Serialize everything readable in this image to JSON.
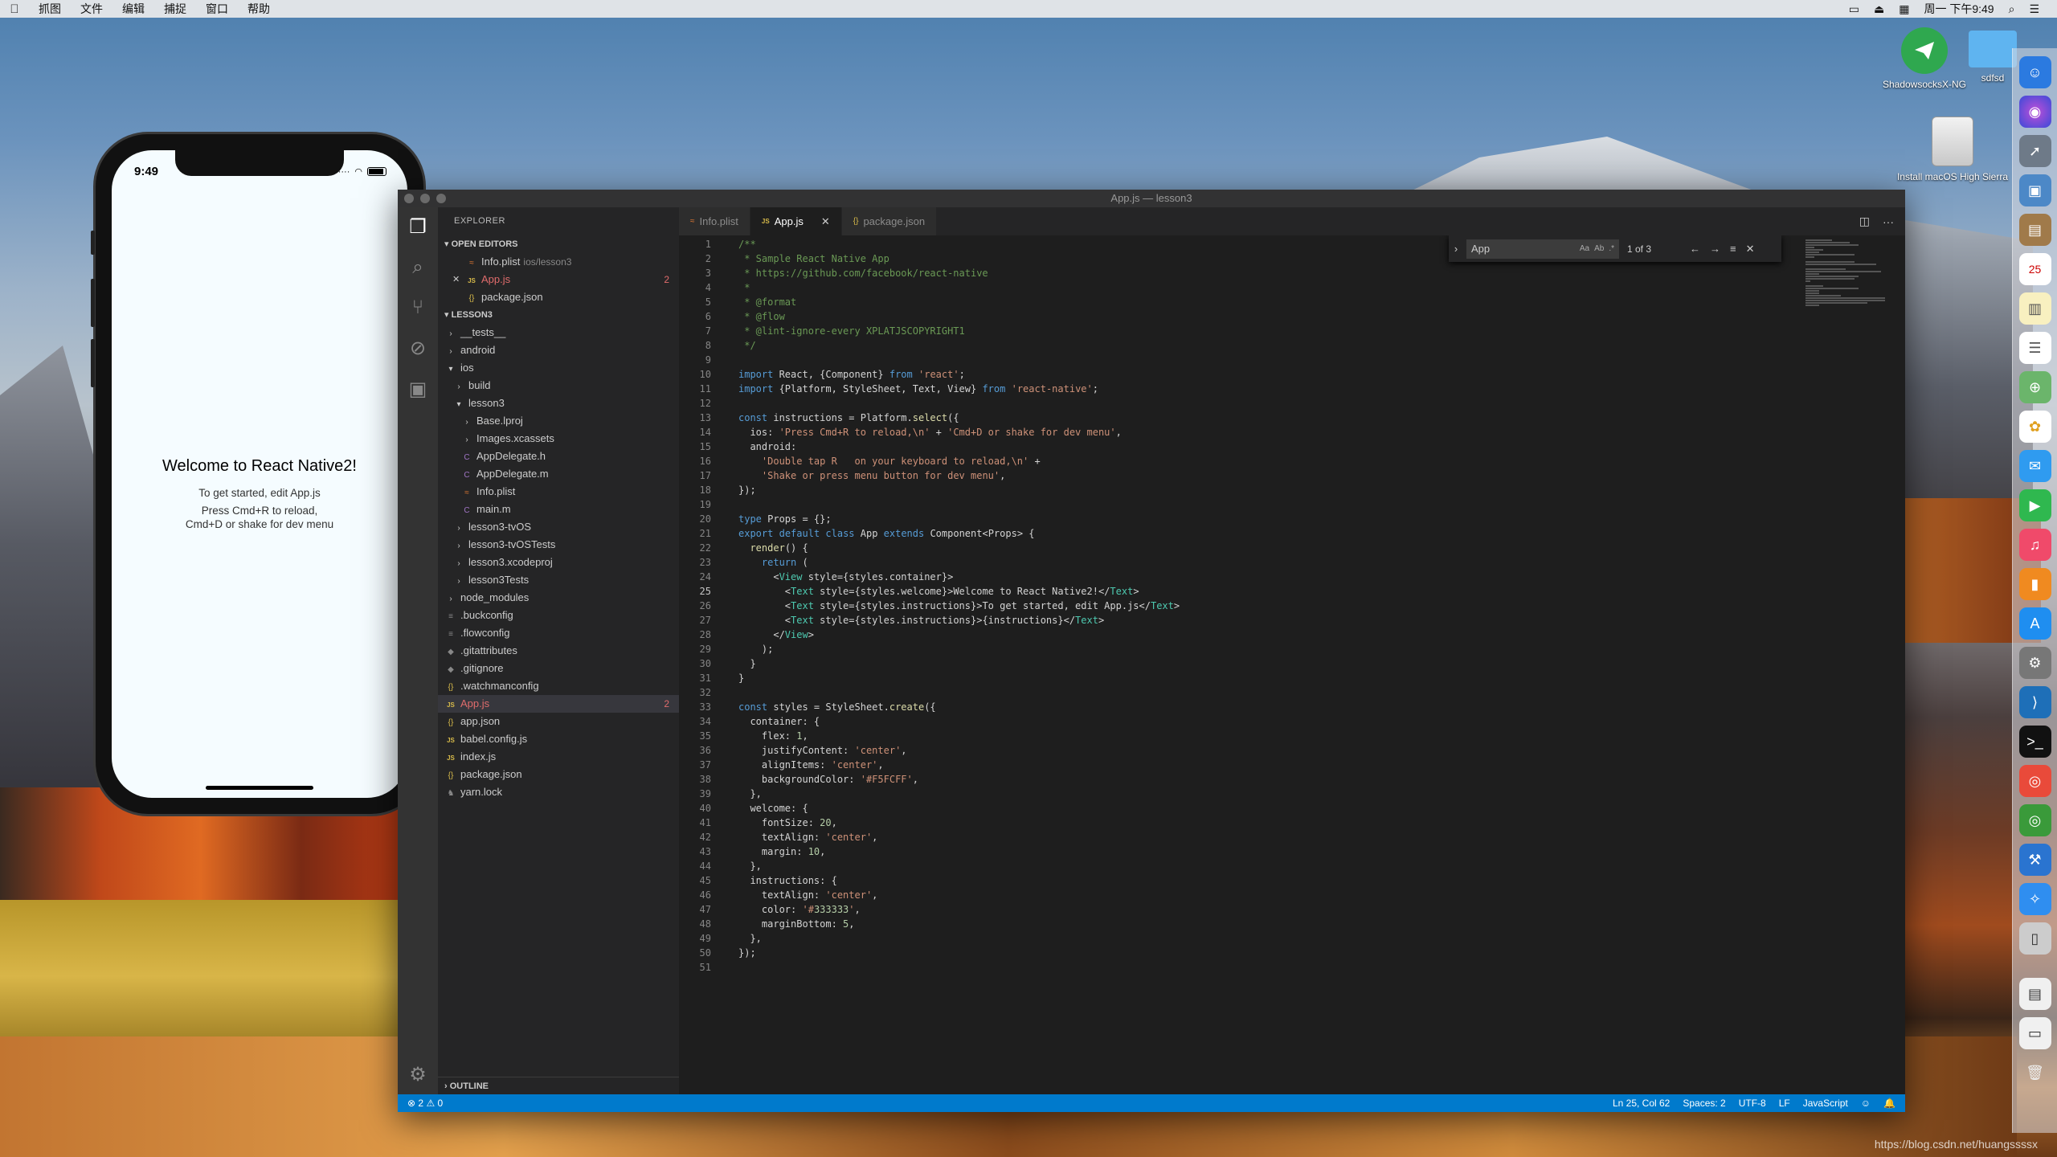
{
  "menubar": {
    "app_menus": [
      "抓图",
      "文件",
      "编辑",
      "捕捉",
      "窗口",
      "帮助"
    ],
    "clock": "周一 下午9:49"
  },
  "desktop": {
    "icons": [
      {
        "label": "ShadowsocksX-NG"
      },
      {
        "label": "sdfsd"
      },
      {
        "label": "Install macOS High Sierra"
      }
    ]
  },
  "phone": {
    "time": "9:49",
    "welcome": "Welcome to React Native2!",
    "instructions": [
      "To get started, edit App.js",
      "Press Cmd+R to reload,",
      "Cmd+D or shake for dev menu"
    ]
  },
  "window": {
    "title": "App.js — lesson3"
  },
  "explorer": {
    "header": "EXPLORER",
    "open_editors_label": "OPEN EDITORS",
    "open_editors": [
      {
        "label": "Info.plist",
        "sub": "ios/lesson3",
        "icon": "plist"
      },
      {
        "label": "App.js",
        "badge": "2",
        "icon": "js",
        "error": true,
        "close": true
      },
      {
        "label": "package.json",
        "icon": "json"
      }
    ],
    "project_label": "LESSON3",
    "tree": [
      {
        "label": "__tests__",
        "icon": "arrow-r",
        "depth": 1
      },
      {
        "label": "android",
        "icon": "arrow-r",
        "depth": 1
      },
      {
        "label": "ios",
        "icon": "arrow-d",
        "depth": 1
      },
      {
        "label": "build",
        "icon": "arrow-r",
        "depth": 2
      },
      {
        "label": "lesson3",
        "icon": "arrow-d",
        "depth": 2
      },
      {
        "label": "Base.lproj",
        "icon": "arrow-r",
        "depth": 3
      },
      {
        "label": "Images.xcassets",
        "icon": "arrow-r",
        "depth": 3
      },
      {
        "label": "AppDelegate.h",
        "icon": "c",
        "depth": 3
      },
      {
        "label": "AppDelegate.m",
        "icon": "c",
        "depth": 3
      },
      {
        "label": "Info.plist",
        "icon": "plist",
        "depth": 3
      },
      {
        "label": "main.m",
        "icon": "c",
        "depth": 3
      },
      {
        "label": "lesson3-tvOS",
        "icon": "arrow-r",
        "depth": 2
      },
      {
        "label": "lesson3-tvOSTests",
        "icon": "arrow-r",
        "depth": 2
      },
      {
        "label": "lesson3.xcodeproj",
        "icon": "arrow-r",
        "depth": 2
      },
      {
        "label": "lesson3Tests",
        "icon": "arrow-r",
        "depth": 2
      },
      {
        "label": "node_modules",
        "icon": "arrow-r",
        "depth": 1
      },
      {
        "label": ".buckconfig",
        "icon": "file",
        "depth": 1
      },
      {
        "label": ".flowconfig",
        "icon": "file",
        "depth": 1
      },
      {
        "label": ".gitattributes",
        "icon": "dot",
        "depth": 1
      },
      {
        "label": ".gitignore",
        "icon": "dot",
        "depth": 1
      },
      {
        "label": ".watchmanconfig",
        "icon": "json",
        "depth": 1
      },
      {
        "label": "App.js",
        "icon": "js",
        "depth": 1,
        "error": true,
        "badge": "2",
        "active": true
      },
      {
        "label": "app.json",
        "icon": "json",
        "depth": 1
      },
      {
        "label": "babel.config.js",
        "icon": "js",
        "depth": 1
      },
      {
        "label": "index.js",
        "icon": "js",
        "depth": 1
      },
      {
        "label": "package.json",
        "icon": "json",
        "depth": 1
      },
      {
        "label": "yarn.lock",
        "icon": "yarn",
        "depth": 1
      }
    ],
    "outline_label": "OUTLINE"
  },
  "tabs": [
    {
      "label": "Info.plist",
      "icon": "plist"
    },
    {
      "label": "App.js",
      "icon": "js",
      "active": true
    },
    {
      "label": "package.json",
      "icon": "json"
    }
  ],
  "find": {
    "query": "App",
    "count": "1 of 3",
    "opt_case": "Aa",
    "opt_word": "Ab",
    "opt_regex": ".*"
  },
  "code": [
    "/**",
    " * Sample React Native App",
    " * https://github.com/facebook/react-native",
    " *",
    " * @format",
    " * @flow",
    " * @lint-ignore-every XPLATJSCOPYRIGHT1",
    " */",
    "",
    "import React, {Component} from 'react';",
    "import {Platform, StyleSheet, Text, View} from 'react-native';",
    "",
    "const instructions = Platform.select({",
    "  ios: 'Press Cmd+R to reload,\\n' + 'Cmd+D or shake for dev menu',",
    "  android:",
    "    'Double tap R   on your keyboard to reload,\\n' +",
    "    'Shake or press menu button for dev menu',",
    "});",
    "",
    "type Props = {};",
    "export default class App extends Component<Props> {",
    "  render() {",
    "    return (",
    "      <View style={styles.container}>",
    "        <Text style={styles.welcome}>Welcome to React Native2!</Text>",
    "        <Text style={styles.instructions}>To get started, edit App.js</Text>",
    "        <Text style={styles.instructions}>{instructions}</Text>",
    "      </View>",
    "    );",
    "  }",
    "}",
    "",
    "const styles = StyleSheet.create({",
    "  container: {",
    "    flex: 1,",
    "    justifyContent: 'center',",
    "    alignItems: 'center',",
    "    backgroundColor: '#F5FCFF',",
    "  },",
    "  welcome: {",
    "    fontSize: 20,",
    "    textAlign: 'center',",
    "    margin: 10,",
    "  },",
    "  instructions: {",
    "    textAlign: 'center',",
    "    color: '#333333',",
    "    marginBottom: 5,",
    "  },",
    "});",
    ""
  ],
  "current_line": 25,
  "statusbar": {
    "errors": "2",
    "warnings": "0",
    "position": "Ln 25, Col 62",
    "spaces": "Spaces: 2",
    "encoding": "UTF-8",
    "eol": "LF",
    "language": "JavaScript"
  },
  "watermark": "https://blog.csdn.net/huangssssx",
  "colors": {
    "accent": "#007acc",
    "keyword": "#569cd6",
    "string": "#ce9178",
    "comment": "#6a9955",
    "tag": "#4ec9b0",
    "error": "#e06c6c"
  }
}
